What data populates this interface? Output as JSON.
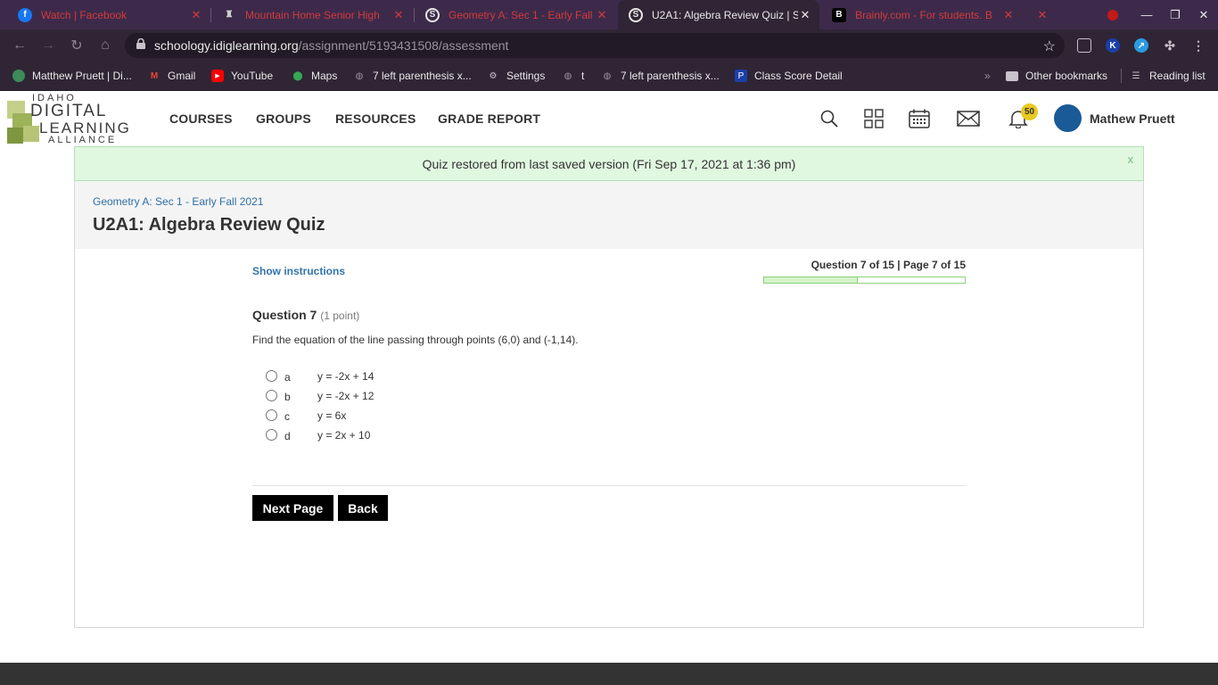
{
  "browser": {
    "tabs": [
      {
        "title": "Watch | Facebook",
        "icon": "facebook-icon",
        "active": false
      },
      {
        "title": "Mountain Home Senior High",
        "icon": "school-icon",
        "active": false
      },
      {
        "title": "Geometry A: Sec 1 - Early Fall",
        "icon": "schoology-icon",
        "active": false
      },
      {
        "title": "U2A1: Algebra Review Quiz | S",
        "icon": "schoology-icon",
        "active": true
      },
      {
        "title": "Brainly.com - For students. B",
        "icon": "brainly-icon",
        "active": false
      }
    ],
    "url_domain": "schoology.idiglearning.org",
    "url_path": "/assignment/5193431508/assessment",
    "bookmarks": [
      {
        "label": "Matthew Pruett | Di...",
        "icon": "globe-icon"
      },
      {
        "label": "Gmail",
        "icon": "gmail-icon"
      },
      {
        "label": "YouTube",
        "icon": "youtube-icon"
      },
      {
        "label": "Maps",
        "icon": "maps-icon"
      },
      {
        "label": "7 left parenthesis x...",
        "icon": "globe-icon"
      },
      {
        "label": "Settings",
        "icon": "gear-icon"
      },
      {
        "label": "t",
        "icon": "globe-icon"
      },
      {
        "label": "7 left parenthesis x...",
        "icon": "globe-icon"
      },
      {
        "label": "Class Score Detail",
        "icon": "powerschool-icon"
      }
    ],
    "other_bookmarks": "Other bookmarks",
    "reading_list": "Reading list"
  },
  "site": {
    "logo": {
      "line1": "IDAHO",
      "line2": "DIGITAL",
      "line3": "LEARNING",
      "line4": "ALLIANCE"
    },
    "nav": [
      "COURSES",
      "GROUPS",
      "RESOURCES",
      "GRADE REPORT"
    ],
    "notification_count": "50",
    "user_name": "Mathew Pruett"
  },
  "flash": {
    "message": "Quiz restored from last saved version (Fri Sep 17, 2021 at 1:36 pm)",
    "close": "x"
  },
  "course": {
    "breadcrumb": "Geometry A: Sec 1 - Early Fall 2021",
    "title": "U2A1: Algebra Review Quiz"
  },
  "quiz": {
    "show_instructions": "Show instructions",
    "counter": "Question 7 of 15 | Page 7 of 15",
    "progress_fraction": 0.4667,
    "question_label": "Question 7",
    "points": "(1 point)",
    "question_text": "Find the equation of the line passing through points (6,0) and (-1,14).",
    "choices": [
      {
        "letter": "a",
        "text": "y = -2x + 14"
      },
      {
        "letter": "b",
        "text": "y = -2x + 12"
      },
      {
        "letter": "c",
        "text": "y = 6x"
      },
      {
        "letter": "d",
        "text": "y = 2x + 10"
      }
    ],
    "next_label": "Next Page",
    "back_label": "Back"
  },
  "colors": {
    "accent_link": "#2f6fa7",
    "flash_bg": "#e0f8e0",
    "progress_border": "#8cd17e",
    "badge": "#e8c821",
    "browser_frame": "#3d2a4b"
  }
}
